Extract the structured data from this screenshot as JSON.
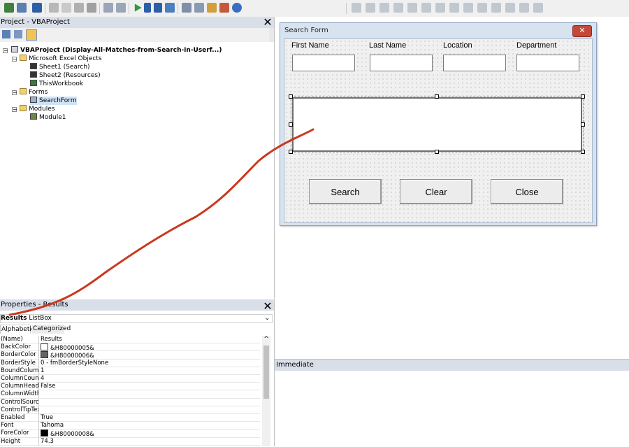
{
  "project": {
    "title": "Project - VBAProject",
    "tree": [
      {
        "label": "VBAProject (Display-All-Matches-from-Search-in-Userf...)",
        "bold": true
      },
      {
        "label": "Microsoft Excel Objects"
      },
      {
        "label": "Sheet1 (Search)"
      },
      {
        "label": "Sheet2 (Resources)"
      },
      {
        "label": "ThisWorkbook"
      },
      {
        "label": "Forms"
      },
      {
        "label": "SearchForm"
      },
      {
        "label": "Modules"
      },
      {
        "label": "Module1"
      }
    ]
  },
  "properties": {
    "title": "Properties - Results",
    "object_name": "Results",
    "object_type": "ListBox",
    "tabs": [
      "Alphabetic",
      "Categorized"
    ],
    "rows": [
      {
        "name": "(Name)",
        "value": "Results"
      },
      {
        "name": "BackColor",
        "value": "&H80000005&"
      },
      {
        "name": "BorderColor",
        "value": "&H80000006&"
      },
      {
        "name": "BorderStyle",
        "value": "0 - fmBorderStyleNone"
      },
      {
        "name": "BoundColumn",
        "value": "1"
      },
      {
        "name": "ColumnCount",
        "value": "4"
      },
      {
        "name": "ColumnHeads",
        "value": "False"
      },
      {
        "name": "ColumnWidths",
        "value": ""
      },
      {
        "name": "ControlSource",
        "value": ""
      },
      {
        "name": "ControlTipText",
        "value": ""
      },
      {
        "name": "Enabled",
        "value": "True"
      },
      {
        "name": "Font",
        "value": "Tahoma"
      },
      {
        "name": "ForeColor",
        "value": "&H80000008&"
      },
      {
        "name": "Height",
        "value": "74.3"
      }
    ]
  },
  "form": {
    "title": "Search Form",
    "labels": [
      "First Name",
      "Last Name",
      "Location",
      "Department"
    ],
    "buttons": [
      "Search",
      "Clear",
      "Close"
    ],
    "close_glyph": "✕"
  },
  "immediate": {
    "title": "Immediate"
  },
  "colors": {
    "annotation": "#c8391f",
    "form_close": "#c4473a"
  }
}
